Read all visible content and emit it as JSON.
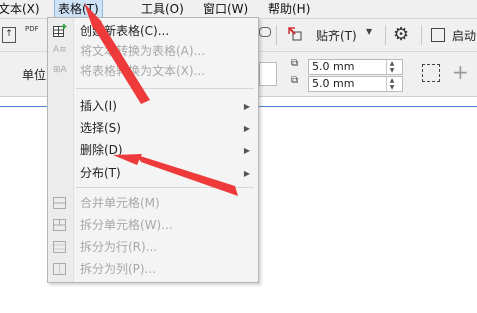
{
  "menubar": {
    "items": [
      {
        "label": "文本(X)"
      },
      {
        "label": "表格(T)"
      },
      {
        "label": "工具(O)"
      },
      {
        "label": "窗口(W)"
      },
      {
        "label": "帮助(H)"
      }
    ]
  },
  "toolbar1": {
    "pdf_label": "PDF",
    "paste_label": "贴齐(T)",
    "launch_label": "启动"
  },
  "toolbar2": {
    "unit_label": "单位",
    "spacing_x": "5.0 mm",
    "spacing_y": "5.0 mm",
    "plus_label": "+"
  },
  "table_menu": {
    "items": [
      {
        "label": "创建新表格(C)...",
        "enabled": true
      },
      {
        "label": "将文本转换为表格(A)...",
        "enabled": false
      },
      {
        "label": "将表格转换为文本(X)...",
        "enabled": false
      },
      {
        "label": "插入(I)",
        "enabled": true,
        "submenu": true
      },
      {
        "label": "选择(S)",
        "enabled": true,
        "submenu": true
      },
      {
        "label": "删除(D)",
        "enabled": true,
        "submenu": true
      },
      {
        "label": "分布(T)",
        "enabled": true,
        "submenu": true
      },
      {
        "label": "合并单元格(M)",
        "enabled": false
      },
      {
        "label": "拆分单元格(W)...",
        "enabled": false
      },
      {
        "label": "拆分为行(R)...",
        "enabled": false
      },
      {
        "label": "拆分为列(P)...",
        "enabled": false
      }
    ]
  },
  "colors": {
    "annotation_arrow": "#ee3a3a",
    "menu_highlight": "#cfe3f7",
    "accent_line": "#4f7fd0"
  }
}
